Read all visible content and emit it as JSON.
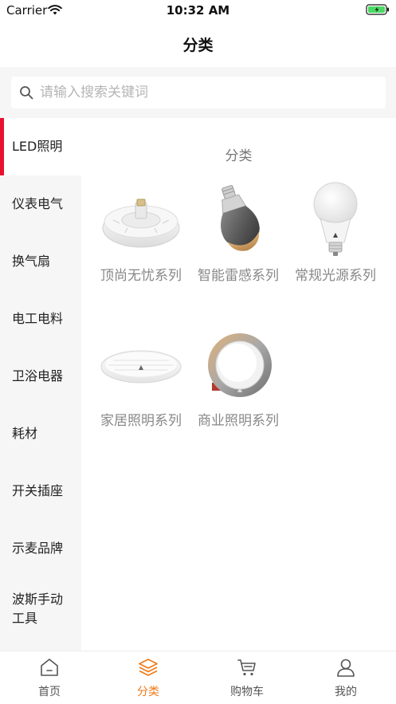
{
  "status_bar": {
    "carrier": "Carrier",
    "time": "10:32 AM"
  },
  "nav": {
    "title": "分类"
  },
  "search": {
    "placeholder": "请输入搜索关键词",
    "value": ""
  },
  "sidebar": {
    "active_index": 0,
    "items": [
      {
        "label": "LED照明"
      },
      {
        "label": "仪表电气"
      },
      {
        "label": "换气扇"
      },
      {
        "label": "电工电料"
      },
      {
        "label": "卫浴电器"
      },
      {
        "label": "耗材"
      },
      {
        "label": "开关插座"
      },
      {
        "label": "示麦品牌"
      },
      {
        "label": "波斯手动工具"
      }
    ]
  },
  "content": {
    "section_title": "分类",
    "products": [
      {
        "name": "顶尚无忧系列",
        "icon": "ceiling-led-lamp"
      },
      {
        "name": "智能雷感系列",
        "icon": "smart-led-bulb"
      },
      {
        "name": "常规光源系列",
        "icon": "led-bulb"
      },
      {
        "name": "家居照明系列",
        "icon": "round-ceiling-lamp"
      },
      {
        "name": "商业照明系列",
        "icon": "downlight"
      }
    ]
  },
  "tab_bar": {
    "active_index": 1,
    "accent": "#f07a18",
    "tabs": [
      {
        "label": "首页",
        "icon": "home-icon"
      },
      {
        "label": "分类",
        "icon": "layers-icon"
      },
      {
        "label": "购物车",
        "icon": "cart-icon"
      },
      {
        "label": "我的",
        "icon": "user-icon"
      }
    ]
  }
}
